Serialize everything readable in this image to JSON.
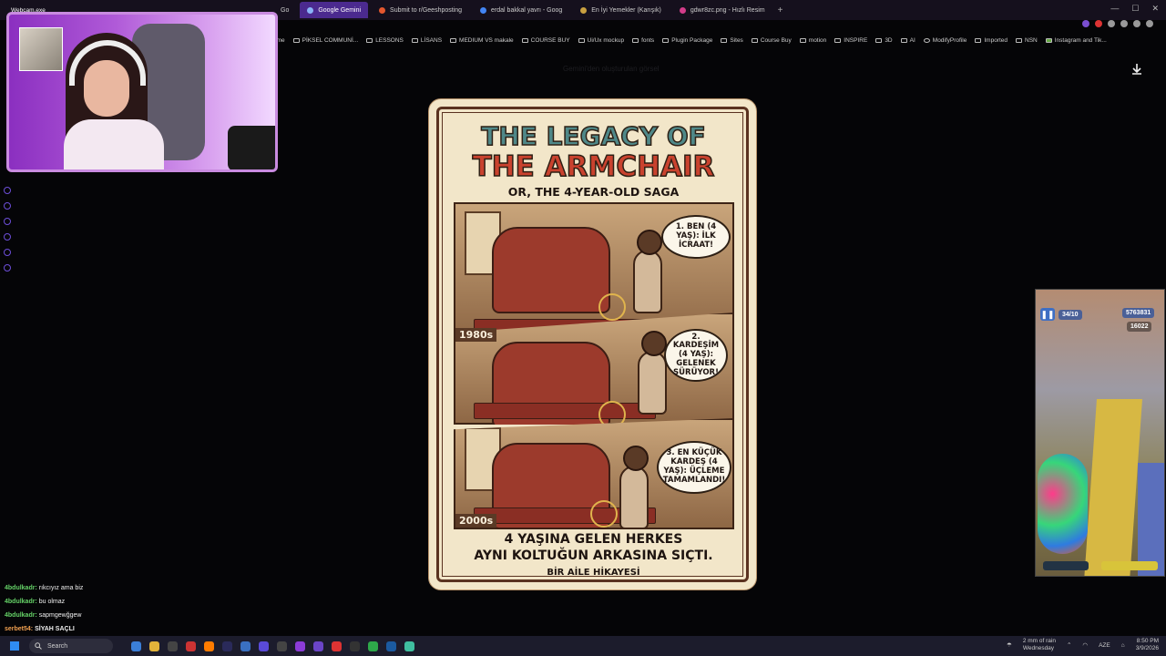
{
  "browser": {
    "tabs": [
      {
        "label": "Google Gemini",
        "active": true
      },
      {
        "label": "Submit to r/Geeshposting",
        "active": false
      },
      {
        "label": "erdal bakkal yavrı - Goog",
        "active": false
      },
      {
        "label": "En İyi Yemekler (Karışık)",
        "active": false
      },
      {
        "label": "gdwr8zc.png - Hızlı Resim",
        "active": false
      }
    ],
    "tab_partial": "Go",
    "new_tab": "+",
    "bookmarks": [
      "ame",
      "PİKSEL COMMUNİ...",
      "LESSONS",
      "LİSANS",
      "MEDIUM VS makale",
      "COURSE BUY",
      "Ui/Ux mockup",
      "fonts",
      "Plugin Package",
      "Sites",
      "Course Buy",
      "motion",
      "INSPIRE",
      "3D",
      "AI",
      "ModifyProfile",
      "Imported",
      "NSN",
      "Instagram and Tik..."
    ],
    "viewer_title": "Gemini'den oluşturulan görsel",
    "accent": "#4b2a8f"
  },
  "webcam": {
    "title": "Webcam.exe"
  },
  "poster": {
    "title_line1": "THE LEGACY OF",
    "title_line2": "THE ARMCHAIR",
    "subtitle": "OR, THE 4-YEAR-OLD SAGA",
    "bubble1": "1. BEN (4 YAŞ): İLK İCRAAT!",
    "bubble2": "2. KARDEŞİM (4 YAŞ): GELENEK SÜRÜYOR!",
    "bubble3": "3. EN KÜÇÜK KARDEŞ (4 YAŞ): ÜÇLEME TAMAMLANDI!",
    "year1": "1980s",
    "year3": "2000s",
    "caption1": "4 YAŞINA GELEN HERKES",
    "caption2": "AYNI KOLTUĞUN ARKASINA SIÇTI.",
    "caption3": "BİR AİLE HİKAYESİ"
  },
  "game": {
    "multiplier": "34/10",
    "score": "5763831",
    "coins": "16022"
  },
  "chat": [
    {
      "user": "4bdulkadr:",
      "msg": "rıkcıyız ama biz"
    },
    {
      "user": "4bdulkadr:",
      "msg": "bu olmaz"
    },
    {
      "user": "4bdulkadr:",
      "msg": "sapmgewğgew"
    },
    {
      "user": "serbet54:",
      "msg": "SİYAH SAÇLI"
    }
  ],
  "taskbar": {
    "search_placeholder": "Search",
    "weather_line1": "2 mm of rain",
    "weather_line2": "Wednesday",
    "lang": "AZE",
    "time": "8:50 PM",
    "date": "3/9/2026"
  }
}
